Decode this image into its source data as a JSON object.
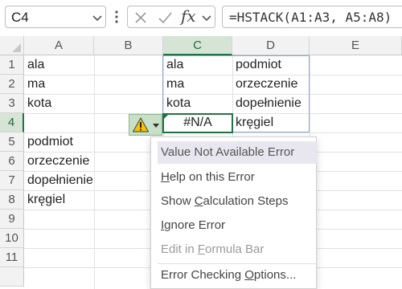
{
  "name_box": {
    "value": "C4"
  },
  "formula_bar": {
    "cancel_icon": "close-icon",
    "enter_icon": "check-icon",
    "fx_label": "fx",
    "formula": "=HSTACK(A1:A3, A5:A8)"
  },
  "columns": [
    "A",
    "B",
    "C",
    "D",
    "E"
  ],
  "rows": [
    "1",
    "2",
    "3",
    "4",
    "5",
    "6",
    "7",
    "8",
    "9",
    "10",
    "11"
  ],
  "selected": {
    "column": "C",
    "row": "4"
  },
  "cells": {
    "A1": "ala",
    "A2": "ma",
    "A3": "kota",
    "A5": "podmiot",
    "A6": "orzeczenie",
    "A7": "dopełnienie",
    "A8": "kręgiel",
    "C1": "ala",
    "C2": "ma",
    "C3": "kota",
    "C4": "#N/A",
    "D1": "podmiot",
    "D2": "orzeczenie",
    "D3": "dopełnienie",
    "D4": "kręgiel"
  },
  "error_button": {
    "icon": "warning-icon",
    "color": "#c7e0c7"
  },
  "error_menu": {
    "title": "Value Not Available Error",
    "help_pre": "",
    "help_u": "H",
    "help_post": "elp on this Error",
    "calc_pre": "Show ",
    "calc_u": "C",
    "calc_post": "alculation Steps",
    "ignore_pre": "",
    "ignore_u": "I",
    "ignore_post": "gnore Error",
    "edit_pre": "Edit in ",
    "edit_u": "F",
    "edit_post": "ormula Bar",
    "options_pre": "Error Checking ",
    "options_u": "O",
    "options_post": "ptions..."
  },
  "colors": {
    "accent": "#217346",
    "spill_border": "#8fa9c9",
    "header_bg": "#f2f2f2"
  }
}
